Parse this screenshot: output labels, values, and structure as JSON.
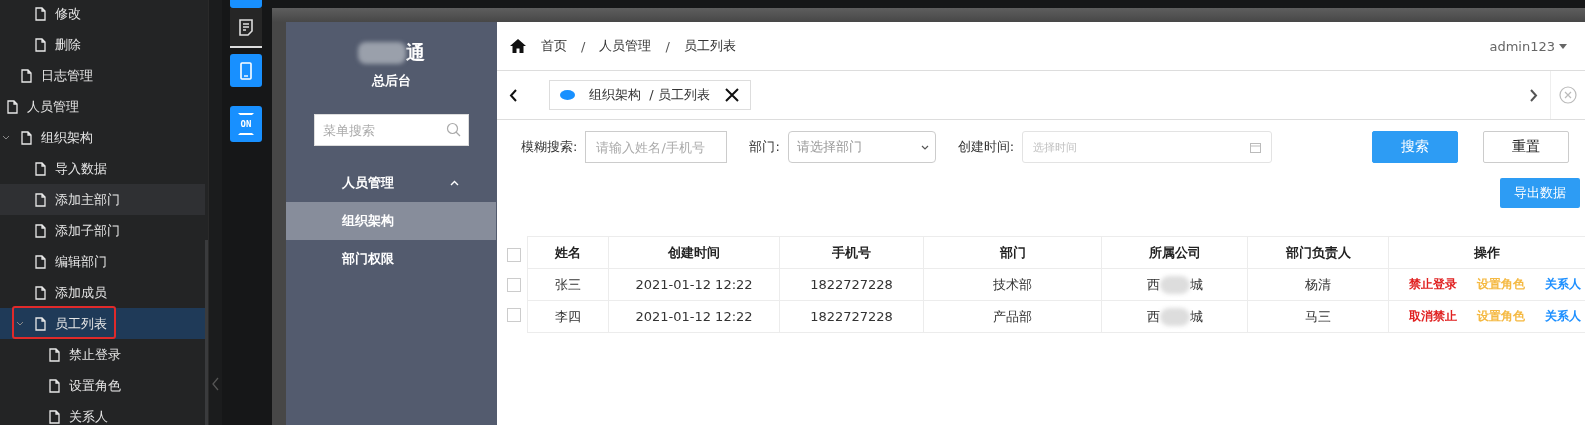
{
  "tree": [
    {
      "children": [
        {
          "children": [
            {
              "label": "修改",
              "expanded": false,
              "hovered": false,
              "selected": false,
              "annotated": false
            },
            {
              "label": "删除",
              "expanded": false,
              "hovered": false,
              "selected": false,
              "annotated": false
            }
          ]
        },
        {
          "label": "日志管理",
          "expanded": false,
          "hovered": false,
          "selected": false,
          "annotated": false
        }
      ]
    },
    {
      "label": "人员管理",
      "expanded": false,
      "hovered": false,
      "selected": false,
      "annotated": false,
      "children": [
        {
          "label": "组织架构",
          "expanded": true,
          "hovered": false,
          "selected": false,
          "annotated": false,
          "children": [
            {
              "label": "导入数据",
              "expanded": false,
              "hovered": false,
              "selected": false,
              "annotated": false
            },
            {
              "label": "添加主部门",
              "expanded": false,
              "hovered": true,
              "selected": false,
              "annotated": false
            },
            {
              "label": "添加子部门",
              "expanded": false,
              "hovered": false,
              "selected": false,
              "annotated": false
            },
            {
              "label": "编辑部门",
              "expanded": false,
              "hovered": false,
              "selected": false,
              "annotated": false
            },
            {
              "label": "添加成员",
              "expanded": false,
              "hovered": false,
              "selected": false,
              "annotated": false
            },
            {
              "label": "员工列表",
              "expanded": true,
              "hovered": false,
              "selected": true,
              "annotated": true,
              "children": [
                {
                  "label": "禁止登录",
                  "expanded": false,
                  "hovered": false,
                  "selected": false,
                  "annotated": false
                },
                {
                  "label": "设置角色",
                  "expanded": false,
                  "hovered": false,
                  "selected": false,
                  "annotated": false
                },
                {
                  "label": "关系人",
                  "expanded": false,
                  "hovered": false,
                  "selected": false,
                  "annotated": false
                }
              ]
            }
          ]
        }
      ]
    }
  ],
  "toolstrip": [
    {
      "kind": "blank"
    },
    {
      "kind": "document"
    },
    {
      "kind": "phone"
    },
    {
      "kind": "badge",
      "text": "ON"
    }
  ],
  "sidebar": {
    "brand": {
      "visible_end": "通"
    },
    "subtitle": "总后台",
    "search_placeholder": "菜单搜索",
    "menu": [
      {
        "label": "人员管理",
        "expanded": true,
        "children": [
          {
            "label": "组织架构",
            "selected": true
          },
          {
            "label": "部门权限",
            "selected": false
          }
        ]
      }
    ]
  },
  "header": {
    "breadcrumb": [
      "首页",
      "人员管理",
      "员工列表"
    ],
    "breadcrumb_separator": "/",
    "user": "admin123"
  },
  "tabs": [
    {
      "label": "组织架构  / 员工列表",
      "selected": true
    }
  ],
  "filters": [
    {
      "kind": "text",
      "label": "模糊搜索:",
      "placeholder": "请输入姓名/手机号"
    },
    {
      "kind": "select",
      "label": "部门:",
      "placeholder": "请选择部门"
    },
    {
      "kind": "date",
      "label": "创建时间:",
      "placeholder": "选择时间"
    }
  ],
  "buttons": [
    {
      "label": "搜索",
      "kind": "primary"
    },
    {
      "label": "重置",
      "kind": "default"
    }
  ],
  "export_button": "导出数据",
  "table": {
    "header_checked": false,
    "columns": [
      "姓名",
      "创建时间",
      "手机号",
      "部门",
      "所属公司",
      "部门负责人",
      "操作"
    ],
    "rows": [
      {
        "checked": false,
        "name": "张三",
        "created": "2021-01-12 12:22",
        "phone": "1822727228",
        "dept": "技术部",
        "company": {
          "visible_start": "西",
          "visible_end": "城"
        },
        "manager": "杨清",
        "actions": [
          {
            "label": "禁止登录",
            "color": "#e02020"
          },
          {
            "label": "设置角色",
            "color": "#f5b942"
          },
          {
            "label": "关系人",
            "color": "#1e90ff"
          }
        ]
      },
      {
        "checked": false,
        "name": "李四",
        "created": "2021-01-12 12:22",
        "phone": "1822727228",
        "dept": "产品部",
        "company": {
          "visible_start": "西",
          "visible_end": "城"
        },
        "manager": "马三",
        "actions": [
          {
            "label": "取消禁止",
            "color": "#e02020"
          },
          {
            "label": "设置角色",
            "color": "#f5b942"
          },
          {
            "label": "关系人",
            "color": "#1e90ff"
          }
        ]
      }
    ]
  }
}
